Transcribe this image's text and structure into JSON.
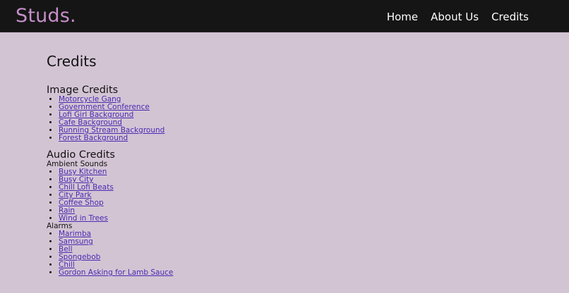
{
  "brand": "Studs.",
  "nav": {
    "items": [
      {
        "label": "Home"
      },
      {
        "label": "About Us"
      },
      {
        "label": "Credits"
      }
    ]
  },
  "page": {
    "title": "Credits"
  },
  "image_credits": {
    "heading": "Image Credits",
    "items": [
      {
        "label": "Motorcycle Gang"
      },
      {
        "label": "Government Conference"
      },
      {
        "label": "Lofi Girl Background"
      },
      {
        "label": "Cafe Background"
      },
      {
        "label": "Running Stream Background"
      },
      {
        "label": "Forest Background"
      }
    ]
  },
  "audio_credits": {
    "heading": "Audio Credits",
    "ambient": {
      "label": "Ambient Sounds",
      "items": [
        {
          "label": "Busy Kitchen"
        },
        {
          "label": "Busy City"
        },
        {
          "label": "Chill Lofi Beats"
        },
        {
          "label": "City Park"
        },
        {
          "label": "Coffee Shop"
        },
        {
          "label": "Rain"
        },
        {
          "label": "Wind in Trees"
        }
      ]
    },
    "alarms": {
      "label": "Alarms",
      "items": [
        {
          "label": "Marimba"
        },
        {
          "label": "Samsung"
        },
        {
          "label": "Bell"
        },
        {
          "label": "Spongebob"
        },
        {
          "label": "Chill"
        },
        {
          "label": "Gordon Asking for Lamb Sauce"
        }
      ]
    }
  },
  "colors": {
    "background": "#d3c4d4",
    "navbar": "#151515",
    "brand": "#c48fc8",
    "link": "#4a2bb0"
  }
}
